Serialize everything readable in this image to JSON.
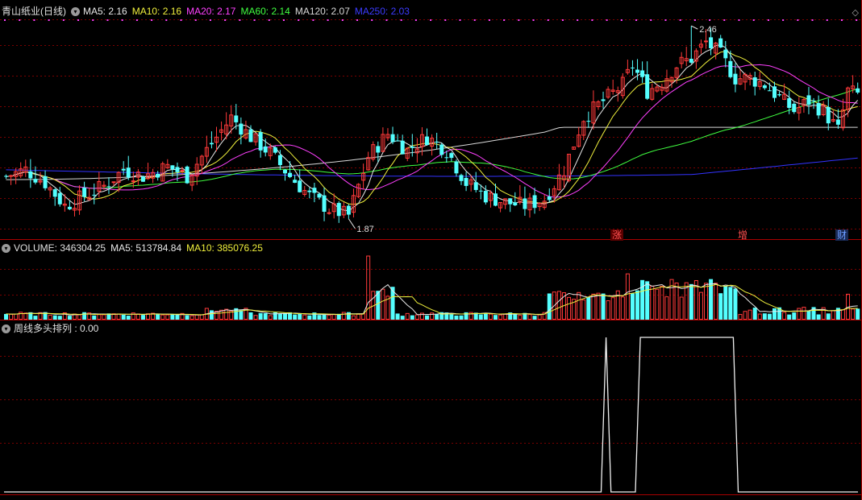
{
  "price_header": {
    "stock_name": "青山纸业(日线)",
    "ma5": "MA5: 2.16",
    "ma10": "MA10: 2.16",
    "ma20": "MA20: 2.17",
    "ma60": "MA60: 2.14",
    "ma120": "MA120: 2.07",
    "ma250": "MA250: 2.03"
  },
  "volume_header": {
    "volume": "VOLUME: 346304.25",
    "ma5": "MA5: 513784.84",
    "ma10": "MA10: 385076.25"
  },
  "indicator_header": {
    "label": "周线多头排列 : 0.00"
  },
  "annotations": {
    "high_label": "2.46",
    "low_label": "1.87"
  },
  "events": [
    {
      "label": "涨",
      "color": "#ff5050"
    },
    {
      "label": "增",
      "color": "#ff5050"
    },
    {
      "label": "财",
      "color": "#6c9cff"
    }
  ],
  "colors": {
    "up": "#ff3a3a",
    "down": "#54ffff",
    "ma5": "#e8e8e8",
    "ma10": "#f0f03c",
    "ma20": "#ff40ff",
    "ma60": "#40ff40",
    "ma120": "#d8d8d8",
    "ma250": "#3333ff",
    "grid": "#7a0000"
  },
  "chart_data": {
    "type": "candlestick",
    "indicator_values": [
      0,
      0,
      0,
      0,
      0,
      0,
      0,
      0,
      0,
      0,
      0,
      0,
      0,
      0,
      0,
      0,
      0,
      0,
      0,
      0,
      0,
      0,
      0,
      0,
      0,
      0,
      0,
      0,
      0,
      0,
      0,
      0,
      0,
      0,
      0,
      0,
      0,
      0,
      0,
      0,
      0,
      0,
      0,
      0,
      0,
      0,
      0,
      0,
      0,
      0,
      0,
      0,
      0,
      0,
      0,
      0,
      0,
      0,
      0,
      0,
      0,
      0,
      0,
      0,
      0,
      0,
      0,
      0,
      0,
      0,
      0,
      0,
      0,
      0,
      0,
      0,
      0,
      0,
      0,
      0,
      0,
      0,
      0,
      0,
      0,
      0,
      0,
      0,
      0,
      0,
      0,
      0,
      0,
      0,
      0,
      0,
      0,
      0,
      0,
      0,
      0,
      0,
      0,
      0,
      0,
      0,
      0,
      0,
      0,
      0,
      0,
      0,
      0,
      0,
      0,
      0,
      0,
      0,
      0,
      0,
      0,
      0,
      0,
      1,
      0,
      0,
      0,
      0,
      0,
      0,
      1,
      1,
      1,
      1,
      1,
      1,
      1,
      1,
      1,
      1,
      1,
      1,
      1,
      1,
      1,
      1,
      1,
      1,
      1,
      1,
      0,
      0,
      0,
      0,
      0,
      0,
      0,
      0,
      0,
      0,
      0,
      0,
      0,
      0,
      0,
      0,
      0,
      0,
      0,
      0
    ]
  }
}
